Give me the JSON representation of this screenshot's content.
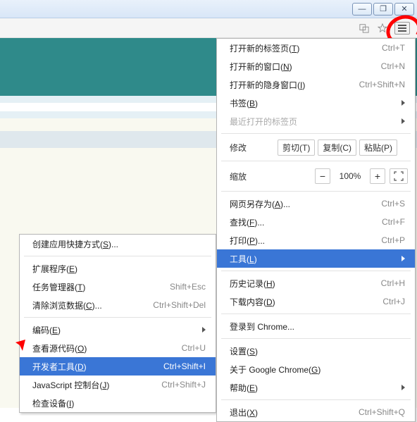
{
  "window_controls": {
    "min": "—",
    "max": "❐",
    "close": "✕"
  },
  "main_menu": {
    "new_tab": {
      "label": "打开新的标签页(T)",
      "hotkey": "T",
      "shortcut": "Ctrl+T"
    },
    "new_window": {
      "label": "打开新的窗口(N)",
      "hotkey": "N",
      "shortcut": "Ctrl+N"
    },
    "incognito": {
      "label": "打开新的隐身窗口(I)",
      "hotkey": "I",
      "shortcut": "Ctrl+Shift+N"
    },
    "bookmarks": {
      "label": "书签(B)",
      "hotkey": "B"
    },
    "recent_tabs": {
      "label": "最近打开的标签页"
    },
    "edit_label": "修改",
    "cut": "剪切(T)",
    "copy": "复制(C)",
    "paste": "粘贴(P)",
    "zoom_label": "缩放",
    "zoom_value": "100%",
    "save_as": {
      "label": "网页另存为(A)...",
      "hotkey": "A",
      "shortcut": "Ctrl+S"
    },
    "find": {
      "label": "查找(F)...",
      "hotkey": "F",
      "shortcut": "Ctrl+F"
    },
    "print": {
      "label": "打印(P)...",
      "hotkey": "P",
      "shortcut": "Ctrl+P"
    },
    "tools": {
      "label": "工具(L)",
      "hotkey": "L"
    },
    "history": {
      "label": "历史记录(H)",
      "hotkey": "H",
      "shortcut": "Ctrl+H"
    },
    "downloads": {
      "label": "下载内容(D)",
      "hotkey": "D",
      "shortcut": "Ctrl+J"
    },
    "signin": {
      "label": "登录到 Chrome..."
    },
    "settings": {
      "label": "设置(S)",
      "hotkey": "S"
    },
    "about": {
      "label": "关于 Google Chrome(G)",
      "hotkey": "G"
    },
    "help": {
      "label": "帮助(E)",
      "hotkey": "E"
    },
    "exit": {
      "label": "退出(X)",
      "hotkey": "X",
      "shortcut": "Ctrl+Shift+Q"
    }
  },
  "sub_menu": {
    "create_shortcut": {
      "label": "创建应用快捷方式(S)...",
      "hotkey": "S"
    },
    "extensions": {
      "label": "扩展程序(E)",
      "hotkey": "E"
    },
    "task_manager": {
      "label": "任务管理器(T)",
      "hotkey": "T",
      "shortcut": "Shift+Esc"
    },
    "clear_data": {
      "label": "清除浏览数据(C)...",
      "hotkey": "C",
      "shortcut": "Ctrl+Shift+Del"
    },
    "encoding": {
      "label": "编码(E)",
      "hotkey": "E"
    },
    "view_source": {
      "label": "查看源代码(O)",
      "hotkey": "O",
      "shortcut": "Ctrl+U"
    },
    "dev_tools": {
      "label": "开发者工具(D)",
      "hotkey": "D",
      "shortcut": "Ctrl+Shift+I"
    },
    "js_console": {
      "label": "JavaScript 控制台(J)",
      "hotkey": "J",
      "shortcut": "Ctrl+Shift+J"
    },
    "inspect_devices": {
      "label": "检查设备(I)",
      "hotkey": "I"
    }
  }
}
